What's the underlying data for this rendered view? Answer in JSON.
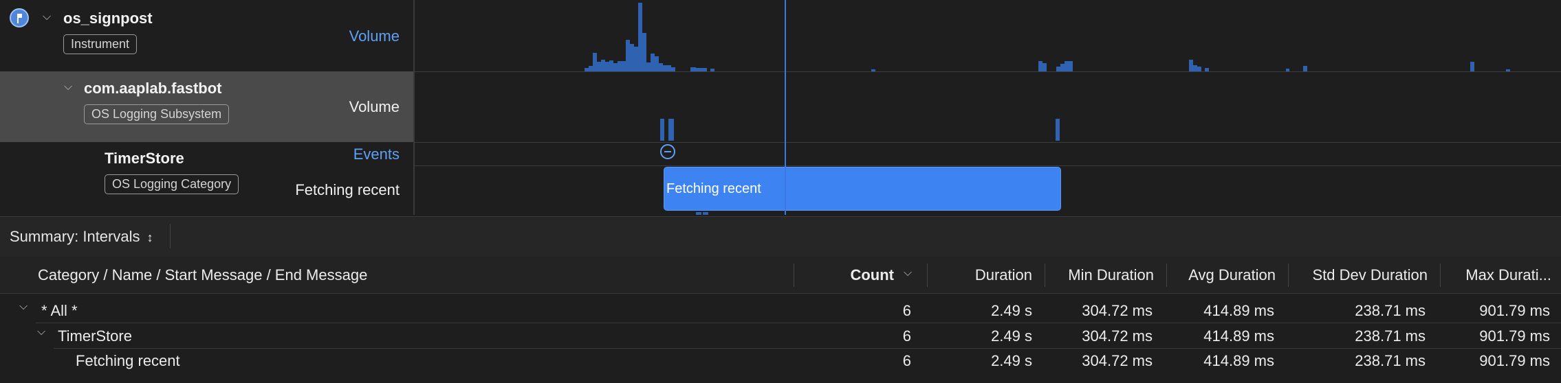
{
  "tracks": {
    "instrument": {
      "name": "os_signpost",
      "tag": "Instrument",
      "lane": "Volume",
      "icon": "signpost-flag-icon"
    },
    "subsystem": {
      "name": "com.aaplab.fastbot",
      "tag": "OS Logging Subsystem",
      "lane": "Volume"
    },
    "category": {
      "name": "TimerStore",
      "tag": "OS Logging Category",
      "events_lane": "Events",
      "interval_lane": "Fetching recent"
    }
  },
  "interval": {
    "label": "Fetching recent"
  },
  "summary": {
    "label": "Summary: Intervals",
    "icon": "updown-chevron-icon"
  },
  "table": {
    "columns": [
      "Category / Name / Start Message / End Message",
      "Count",
      "Duration",
      "Min Duration",
      "Avg Duration",
      "Std Dev Duration",
      "Max Durati..."
    ],
    "sort_icon": "chevron-down-icon",
    "rows": [
      {
        "name": "* All *",
        "count": "6",
        "duration": "2.49 s",
        "min": "304.72 ms",
        "avg": "414.89 ms",
        "std": "238.71 ms",
        "max": "901.79 ms"
      },
      {
        "name": "TimerStore",
        "count": "6",
        "duration": "2.49 s",
        "min": "304.72 ms",
        "avg": "414.89 ms",
        "std": "238.71 ms",
        "max": "901.79 ms"
      },
      {
        "name": "Fetching recent",
        "count": "6",
        "duration": "2.49 s",
        "min": "304.72 ms",
        "avg": "414.89 ms",
        "std": "238.71 ms",
        "max": "901.79 ms"
      }
    ]
  },
  "colors": {
    "accent": "#3d84f2",
    "volume_bar": "#2f62b0",
    "link": "#5fa0f5"
  }
}
